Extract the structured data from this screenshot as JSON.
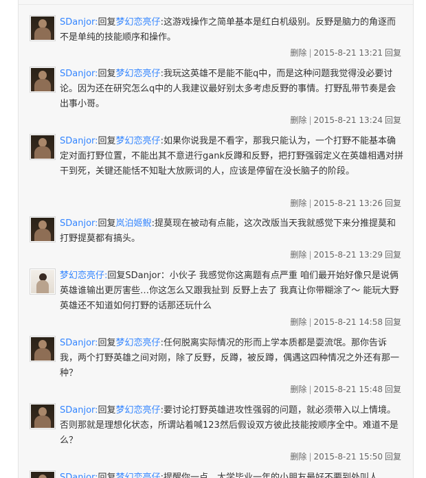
{
  "labels": {
    "reply_word": "回复",
    "delete": "删除",
    "reply_button": "回复",
    "separator": "|"
  },
  "replies": [
    {
      "author": "SDanjor:",
      "target": "梦幻恋亮仔",
      "text": ":这游戏操作之简单基本是红白机级别。反野是脑力的角逐而不是单纯的技能顺序和操作。",
      "time": "2015-8-21 13:21",
      "avatar": "dark"
    },
    {
      "author": "SDanjor:",
      "target": "梦幻恋亮仔",
      "text": ":我玩这英雄不是能不能q中，而是这种问题我觉得没必要讨论。因为还在研究怎么q中的人我建议最好别太多考虑反野的事情。打野乱带节奏是会出事小哥。",
      "time": "2015-8-21 13:24",
      "avatar": "dark"
    },
    {
      "author": "SDanjor:",
      "target": "梦幻恋亮仔",
      "text": ":如果你说我是不看字，那我只能认为，一个打野不能基本确定对面打野位置，不能出其不意进行gank反蹲和反野，把打野强弱定义在英雄相遇对拼干到死，关键还能恬不知耻大放厥词的人，应该是停留在没长脑子的阶段。",
      "time": "2015-8-21 13:26",
      "avatar": "dark"
    },
    {
      "author": "SDanjor:",
      "target": "岚泊姬鲵",
      "text": ":提莫现在被动有点能，这次改版当天我就感觉下来分推提莫和打野提莫都有搞头。",
      "time": "2015-8-21 13:29",
      "avatar": "dark"
    },
    {
      "author": "梦幻恋亮仔:",
      "target": "",
      "plain_target": "SDanjor",
      "text": "：小伙子 我感觉你这离题有点严重 咱们最开始好像只是说俩英雄谁输出更厉害些…你这怎么又跟我扯到 反野上去了 我真让你带糊涂了～ 能玩大野英雄还不知道如何打野的话那还玩什么",
      "time": "2015-8-21 14:58",
      "avatar": "light"
    },
    {
      "author": "SDanjor:",
      "target": "梦幻恋亮仔",
      "text": ":任何脱离实际情况的形而上学本质都是耍流氓。那你告诉我，两个打野英雄之间对刚，除了反野，反蹲，被反蹲，偶遇这四种情况之外还有那一种？",
      "time": "2015-8-21 15:48",
      "avatar": "dark"
    },
    {
      "author": "SDanjor:",
      "target": "梦幻恋亮仔",
      "text": ":要讨论打野英雄进攻性强弱的问题，就必须带入以上情境。否则那就是理想化状态，所谓站着喊123然后假设双方彼此技能按顺序全中。难道不是么？",
      "time": "2015-8-21 15:50",
      "avatar": "dark"
    },
    {
      "author": "SDanjor:",
      "target": "梦幻恋亮仔",
      "text": ":提醒你一点，大学毕业一年的小朋友最好不要到处叫人",
      "time": "",
      "avatar": "dark"
    }
  ]
}
